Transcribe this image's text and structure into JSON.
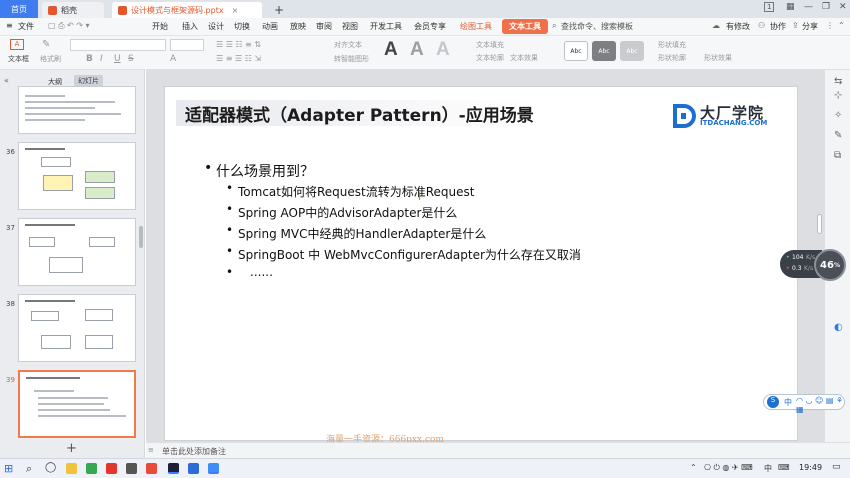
{
  "tabs": {
    "home": "首页",
    "doc": "稻壳",
    "file": "设计模式与框架源码.pptx",
    "add": "+"
  },
  "window": {
    "page_badge": "1",
    "minimize": "—",
    "restore": "❐",
    "close": "✕"
  },
  "menu": {
    "file": "文件",
    "items": [
      "开始",
      "插入",
      "设计",
      "切换",
      "动画",
      "放映",
      "审阅",
      "视图",
      "开发工具",
      "会员专享"
    ],
    "drawing_tools": "绘图工具",
    "text_tools": "文本工具",
    "search": "查找命令、搜索模板",
    "edit_status": "有修改",
    "collab": "协作",
    "share": "分享"
  },
  "toolbar": {
    "textbox": "文本框",
    "text_styles": [
      "A",
      "A",
      "A"
    ],
    "shape_styles": [
      "Abc",
      "Abc",
      "Abc"
    ],
    "align_text": "对齐文本",
    "convert_smartart": "转智能图形",
    "text_fill": "文本填充",
    "text_outline": "文本轮廓",
    "text_effect": "文本效果",
    "shape_fill": "形状填充",
    "shape_outline": "形状轮廓",
    "shape_effect": "形状效果",
    "font_buttons": [
      "B",
      "I",
      "U",
      "S",
      "A"
    ]
  },
  "panel": {
    "outline_tab": "大纲",
    "slides_tab": "幻灯片",
    "slide_numbers": [
      "36",
      "37",
      "38",
      "39"
    ],
    "add_button": "+"
  },
  "slide": {
    "title": "适配器模式（Adapter Pattern）-应用场景",
    "logo_main": "大厂学院",
    "logo_sub": "ITDACHANG.COM",
    "bullet_main": "什么场景用到？",
    "sub_bullets": [
      "Tomcat如何将Request流转为标准Request",
      "Spring AOP中的AdvisorAdapter是什么",
      "Spring MVC中经典的HandlerAdapter是什么",
      "SpringBoot 中 WebMvcConfigurerAdapter为什么存在又取消",
      "......"
    ]
  },
  "notes": {
    "placeholder": "单击此处添加备注"
  },
  "watermark": "海量一手资源：666pxx.com",
  "monitor": {
    "up": "104",
    "up_unit": "K/s",
    "down": "0.3",
    "down_unit": "K/s",
    "cpu": "46",
    "cpu_unit": "%"
  },
  "ime": {
    "mode": "中"
  },
  "taskbar": {
    "time": "19:49",
    "lang": "中"
  },
  "colors": {
    "accent": "#f0704a",
    "home_tab": "#3e7cf0",
    "logo_blue": "#1c6fd0"
  }
}
